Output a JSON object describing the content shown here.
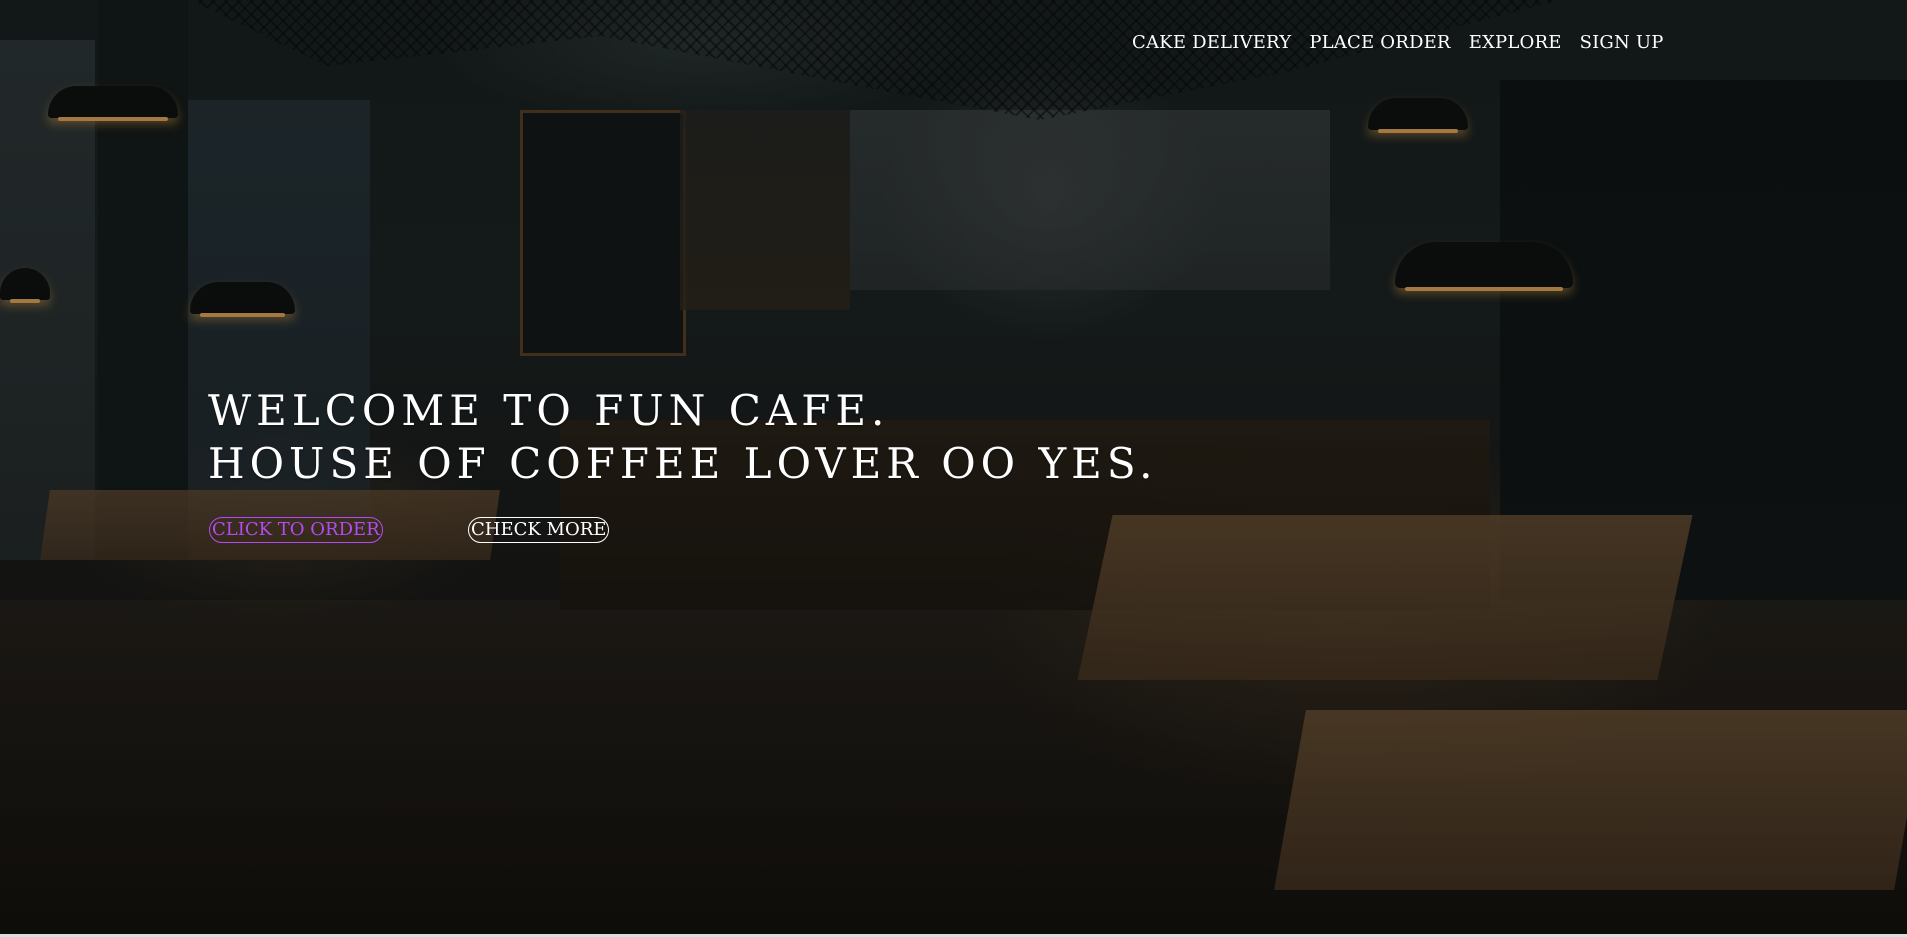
{
  "nav": {
    "items": [
      {
        "label": "CAKE DELIVERY"
      },
      {
        "label": "PLACE ORDER"
      },
      {
        "label": "EXPLORE"
      },
      {
        "label": "SIGN UP"
      }
    ]
  },
  "hero": {
    "headline_line1": "WELCOME TO FUN CAFE.",
    "headline_line2": "HOUSE OF COFFEE LOVER OO YES.",
    "primary_button": "CLICK TO ORDER",
    "secondary_button": "CHECK MORE"
  },
  "colors": {
    "accent": "#b24cf0",
    "text": "#ffffff"
  }
}
